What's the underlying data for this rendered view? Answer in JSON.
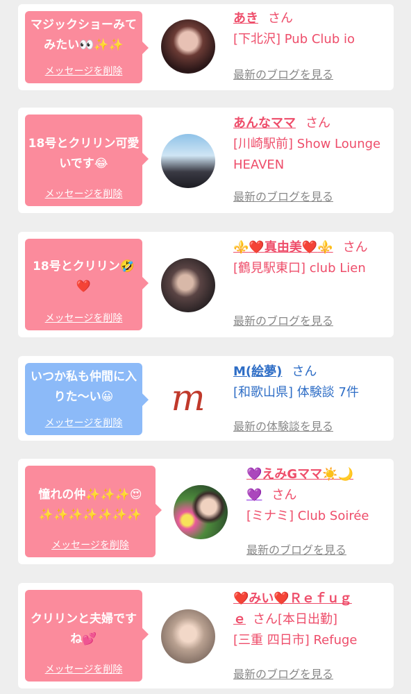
{
  "colors": {
    "pink_bubble": "#fb8b9c",
    "blue_bubble": "#8cbaf8",
    "name_pink": "#ee4d6a",
    "name_blue": "#2f6ec6",
    "link_gray": "#888888",
    "background": "#eeeeee"
  },
  "honorific": "さん",
  "entries": [
    {
      "message": "マジックショーみてみたい👀✨✨",
      "delete_label": "メッセージを削除",
      "name": "あき",
      "shop": "[下北沢] Pub Club io",
      "link": "最新のブログを見る"
    },
    {
      "message": "18号とクリリン可愛いです😂",
      "delete_label": "メッセージを削除",
      "name": "あんなママ",
      "shop": "[川崎駅前] Show Lounge HEAVEN",
      "link": "最新のブログを見る"
    },
    {
      "message": "18号とクリリン🤣❤️",
      "delete_label": "メッセージを削除",
      "name_prefix": "⚜️",
      "name_heart": "❤️",
      "name": "真由美",
      "name_heart2": "❤️",
      "name_suffix": "⚜️",
      "shop": "[鶴見駅東口] club Lien",
      "link": "最新のブログを見る"
    },
    {
      "message": "いつか私も仲間に入りた〜い😀",
      "delete_label": "メッセージを削除",
      "name": "M(絵夢)",
      "shop": "[和歌山県] 体験談 7件",
      "link": "最新の体験談を見る",
      "avatar_letter": "m"
    },
    {
      "message": "憧れの仲✨✨✨😍✨✨✨✨✨✨✨",
      "delete_label": "メッセージを削除",
      "name_prefix": "💜",
      "name": "えみGママ",
      "name_suffix": "☀️🌙",
      "name_line2": "💜",
      "shop": "[ミナミ] Club Soirée",
      "link": "最新のブログを見る"
    },
    {
      "message": "クリリンと夫婦ですね💕",
      "delete_label": "メッセージを削除",
      "name_prefix": "❤️",
      "name": "みい",
      "name_heart": "❤️",
      "name_suffix": "Ｒｅｆｕｇ",
      "name_line2": "ｅ",
      "status": "[本日出勤]",
      "shop": "[三重 四日市] Refuge",
      "link": "最新のブログを見る"
    }
  ]
}
